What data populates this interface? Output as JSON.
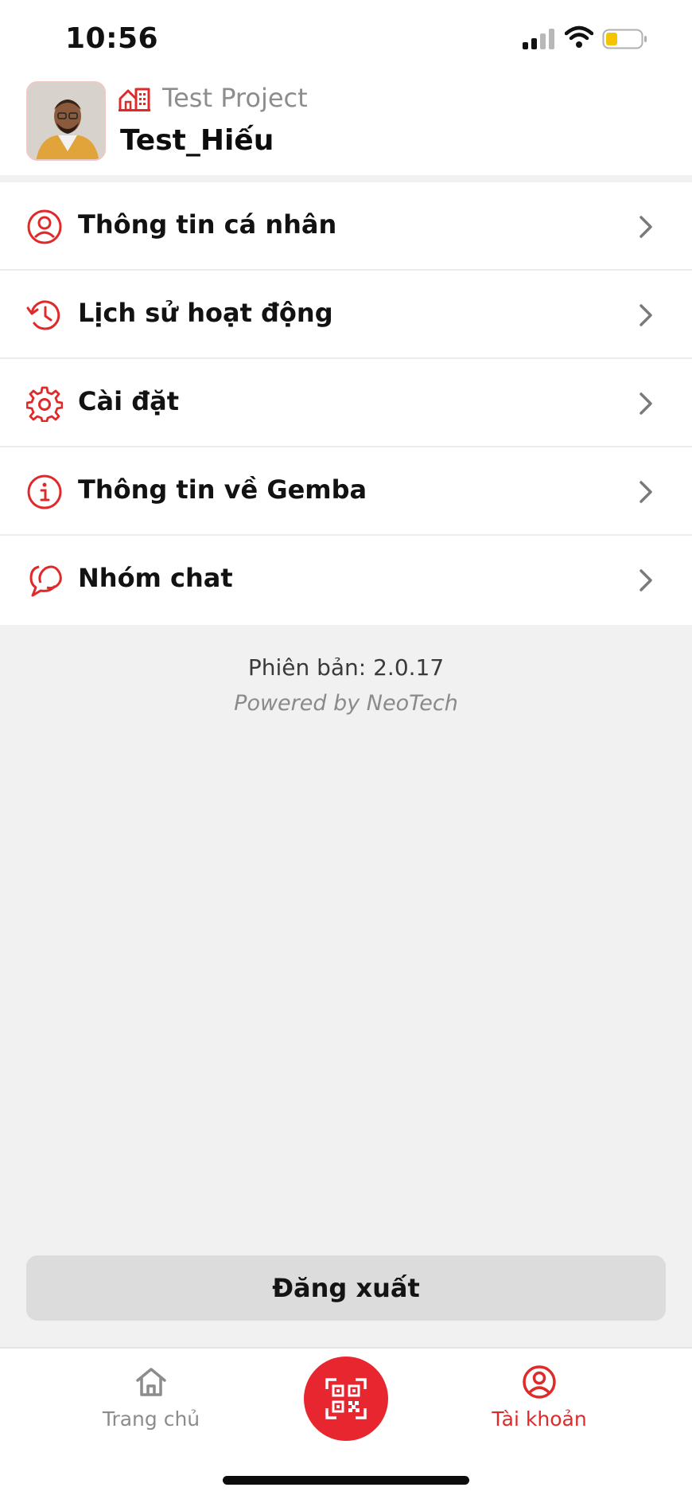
{
  "status_bar": {
    "time": "10:56"
  },
  "header": {
    "project_name": "Test Project",
    "user_name": "Test_Hiếu"
  },
  "menu": {
    "items": [
      {
        "label": "Thông tin cá nhân",
        "icon": "user-circle-icon"
      },
      {
        "label": "Lịch sử hoạt động",
        "icon": "history-icon"
      },
      {
        "label": "Cài đặt",
        "icon": "gear-icon"
      },
      {
        "label": "Thông tin về Gemba",
        "icon": "info-icon"
      },
      {
        "label": "Nhóm chat",
        "icon": "chat-bubbles-icon"
      }
    ]
  },
  "footer": {
    "version": "Phiên bản: 2.0.17",
    "powered_by": "Powered by NeoTech"
  },
  "logout_label": "Đăng xuất",
  "tabbar": {
    "home_label": "Trang chủ",
    "account_label": "Tài khoản",
    "scan_icon": "qr-scan-icon"
  },
  "colors": {
    "accent": "#e8262f",
    "background": "#f1f1f1"
  }
}
